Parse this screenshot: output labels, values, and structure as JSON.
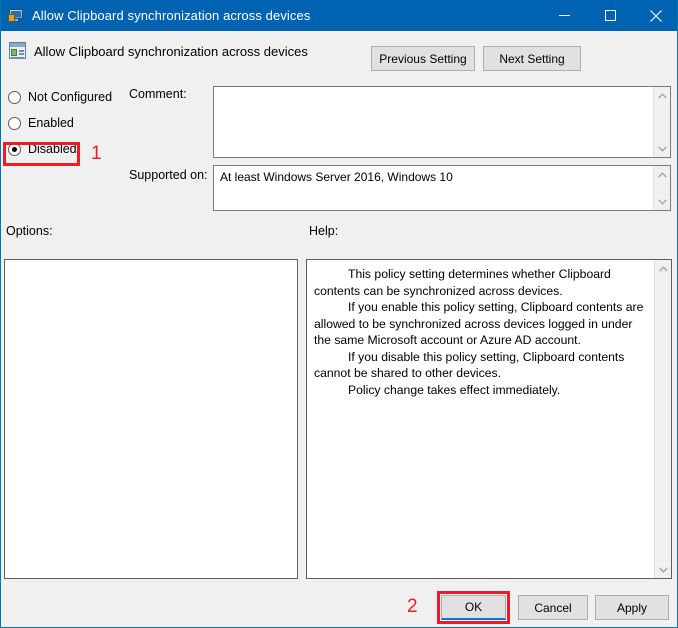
{
  "window": {
    "title": "Allow Clipboard synchronization across devices",
    "accent_color": "#0063b1",
    "annotation_color": "#ee1c25",
    "controls": {
      "minimize": "minimize-button",
      "maximize": "maximize-button",
      "close": "close-button"
    }
  },
  "header": {
    "title": "Allow Clipboard synchronization across devices",
    "previous_setting_label": "Previous Setting",
    "next_setting_label": "Next Setting"
  },
  "settings": {
    "selected": "Disabled",
    "options": [
      {
        "label": "Not Configured",
        "checked": false
      },
      {
        "label": "Enabled",
        "checked": false
      },
      {
        "label": "Disabled",
        "checked": true
      }
    ]
  },
  "comment": {
    "label": "Comment:",
    "value": "",
    "placeholder": ""
  },
  "supported_on": {
    "label": "Supported on:",
    "value": "At least Windows Server 2016, Windows 10"
  },
  "panels": {
    "options_label": "Options:",
    "options_content": "",
    "help_label": "Help:",
    "help_paragraphs": [
      "This policy setting determines whether Clipboard contents can be synchronized across devices.",
      "If you enable this policy setting, Clipboard contents are allowed to be synchronized across devices logged in under the same Microsoft account or Azure AD account.",
      "If you disable this policy setting, Clipboard contents cannot be shared to other devices.",
      "Policy change takes effect immediately."
    ]
  },
  "footer": {
    "ok_label": "OK",
    "cancel_label": "Cancel",
    "apply_label": "Apply"
  },
  "annotations": [
    {
      "number": "1",
      "target": "Disabled radio button"
    },
    {
      "number": "2",
      "target": "OK button"
    }
  ]
}
